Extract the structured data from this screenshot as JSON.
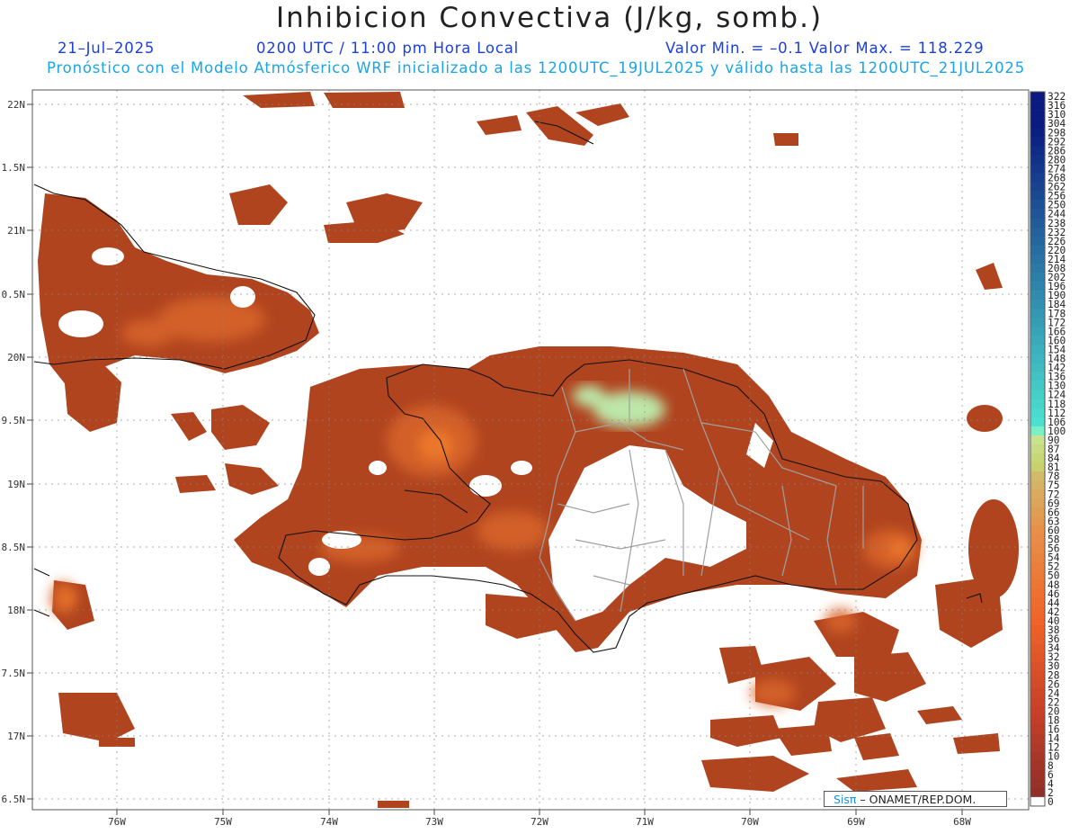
{
  "header": {
    "title": "Inhibicion Convectiva (J/kg, somb.)",
    "date": "21–Jul–2025",
    "time": "0200 UTC / 11:00 pm Hora Local",
    "minmax": "Valor Min. = –0.1  Valor Max. = 118.229",
    "model_info": "Pronóstico con el Modelo Atmósferico WRF inicializado a las 1200UTC_19JUL2025 y válido hasta las  1200UTC_21JUL2025"
  },
  "axes": {
    "lon_labels": [
      "76W",
      "75W",
      "74W",
      "73W",
      "72W",
      "71W",
      "70W",
      "69W",
      "68W"
    ],
    "lat_labels": [
      "22N",
      "1.5N",
      "21N",
      "0.5N",
      "20N",
      "9.5N",
      "19N",
      "8.5N",
      "18N",
      "7.5N",
      "17N",
      "6.5N"
    ]
  },
  "colorbar": {
    "labels": [
      "322",
      "316",
      "310",
      "304",
      "298",
      "292",
      "286",
      "280",
      "274",
      "268",
      "262",
      "256",
      "250",
      "244",
      "238",
      "232",
      "226",
      "220",
      "214",
      "208",
      "202",
      "196",
      "190",
      "184",
      "178",
      "172",
      "166",
      "160",
      "154",
      "148",
      "142",
      "136",
      "130",
      "124",
      "118",
      "112",
      "106",
      "100",
      "90",
      "87",
      "84",
      "81",
      "78",
      "75",
      "72",
      "69",
      "66",
      "63",
      "60",
      "58",
      "56",
      "54",
      "52",
      "50",
      "48",
      "46",
      "44",
      "42",
      "40",
      "38",
      "36",
      "34",
      "32",
      "30",
      "28",
      "26",
      "24",
      "22",
      "20",
      "18",
      "16",
      "14",
      "12",
      "10",
      "8",
      "6",
      "4",
      "2",
      "0"
    ]
  },
  "credit": {
    "logo": "Sisπ",
    "text": " – ONAMET/REP.DOM."
  },
  "colors": {
    "field_base": "#b0441f",
    "field_light": "#d9652b",
    "field_hot": "#f07a2c",
    "field_peak": "#bdf0b0",
    "coast": "#111111",
    "borders": "#a0a0a0"
  }
}
